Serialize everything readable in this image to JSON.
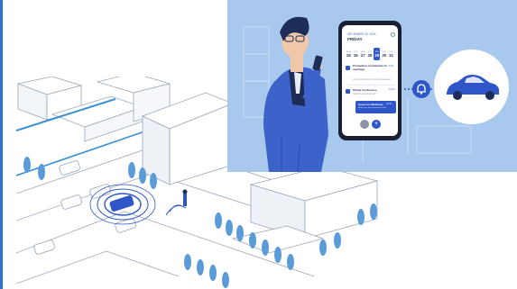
{
  "colors": {
    "accent": "#2e56c8",
    "panel_background": "#a9c8ee",
    "city_line": "#8fa1b3",
    "city_highlight": "#3a8fd4"
  },
  "icons": [
    "bell-icon",
    "car-icon",
    "calendar-gear-icon",
    "add-icon",
    "check-icon"
  ],
  "calendar_app": {
    "date": "DÉCEMBRE 25, 2023",
    "weekday": "FRIDAY",
    "week_days": [
      {
        "name": "MON",
        "num": "25"
      },
      {
        "name": "TUE",
        "num": "26"
      },
      {
        "name": "WED",
        "num": "27"
      },
      {
        "name": "THU",
        "num": "28"
      },
      {
        "name": "FRI",
        "num": "29"
      },
      {
        "name": "SAT",
        "num": "30"
      },
      {
        "name": "SUN",
        "num": "31"
      }
    ],
    "selected_day_index": 4,
    "events": [
      {
        "title": "Production of materials for meetings",
        "time": "8:30",
        "subtitle": "Lorem ipsum dolor sit amet consectetur"
      },
      {
        "title": "Online Conference",
        "time": "10:00",
        "subtitle": "Notify the host that I will"
      },
      {
        "title": "In-person Meetings",
        "time": "11:00",
        "subtitle": "Notify your text participant hello"
      }
    ],
    "add_button": "+"
  }
}
